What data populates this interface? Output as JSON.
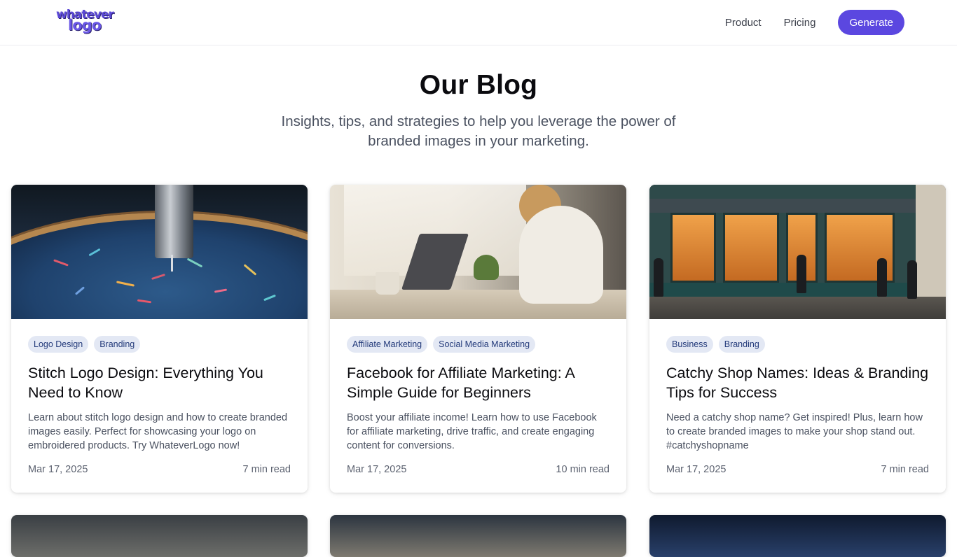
{
  "header": {
    "logo_line1": "whatever",
    "logo_line2": "logo",
    "nav": [
      "Product",
      "Pricing"
    ],
    "cta": "Generate"
  },
  "hero": {
    "title": "Our Blog",
    "subtitle": "Insights, tips, and strategies to help you leverage the power of branded images in your marketing."
  },
  "posts": [
    {
      "tags": [
        "Logo Design",
        "Branding"
      ],
      "title": "Stitch Logo Design: Everything You Need to Know",
      "excerpt": "Learn about stitch logo design and how to create branded images easily. Perfect for showcasing your logo on embroidered products. Try WhateverLogo now!",
      "date": "Mar 17, 2025",
      "read_time": "7 min read",
      "image": "embroidery-hoop-photo"
    },
    {
      "tags": [
        "Affiliate Marketing",
        "Social Media Marketing"
      ],
      "title": "Facebook for Affiliate Marketing: A Simple Guide for Beginners",
      "excerpt": "Boost your affiliate income! Learn how to use Facebook for affiliate marketing, drive traffic, and create engaging content for conversions.",
      "date": "Mar 17, 2025",
      "read_time": "10 min read",
      "image": "woman-laptop-photo"
    },
    {
      "tags": [
        "Business",
        "Branding"
      ],
      "title": "Catchy Shop Names: Ideas & Branding Tips for Success",
      "excerpt": "Need a catchy shop name? Get inspired! Plus, learn how to create branded images to make your shop stand out. #catchyshopname",
      "date": "Mar 17, 2025",
      "read_time": "7 min read",
      "image": "storefront-photo"
    }
  ],
  "colors": {
    "brand": "#5b47e0",
    "tag_bg": "#e3e8f4",
    "tag_text": "#233a7a",
    "muted_text": "#4a5160"
  }
}
